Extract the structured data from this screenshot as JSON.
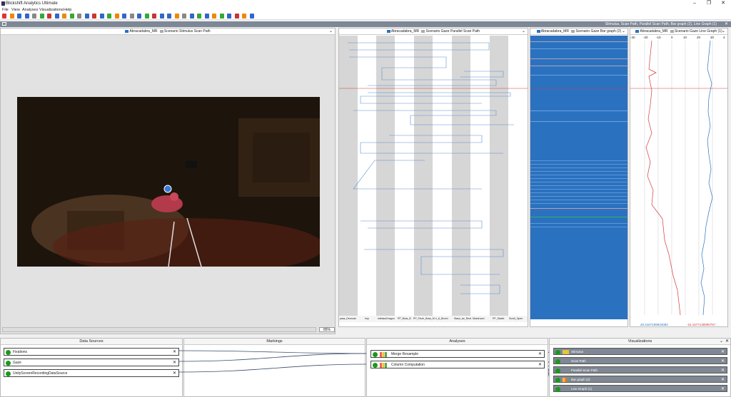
{
  "window": {
    "title": "Blickshift Analytics Ultimate",
    "minimize": "–",
    "maximize": "❐",
    "close": "✕"
  },
  "menu": [
    "File",
    "View",
    "Analyses",
    "Visualizations",
    "Help"
  ],
  "workspace": {
    "title": "Stimulus, Scan Path, Parallel Scan Path, Bar graph (2), Line Graph (1)"
  },
  "stimulus_panel": {
    "legend_a": "Abracadabra_MR",
    "legend_b": "Scenario Stimulus Scan Path",
    "zoom": "85",
    "zoom_unit": "%"
  },
  "parallel_panel": {
    "legend_a": "Abracadabra_MR",
    "legend_b": "Scenario Gaze Parallel Scan Path",
    "columns": [
      "pass_Dermola",
      "imp",
      "intefaceDragon",
      "PP_Boss_B",
      "PP_Finch_Boss_M",
      "n_A_Bronn",
      "Stasu_lar_Rest",
      "Mushroom",
      "PP_Skelet",
      "Scroll_Open"
    ]
  },
  "bar_panel": {
    "legend_a": "Abracadabra_MR",
    "legend_b": "Scenario Gaze Bar graph (2)"
  },
  "line_panel": {
    "legend_a": "Abracadabra_MR",
    "legend_b": "Scenario Gaze Line Graph (1)",
    "ticks": [
      "-30",
      "-20",
      "-10",
      "0",
      "10",
      "20",
      "30",
      "4"
    ],
    "value_left": "20.4167199944092",
    "value_right": "-15.1577138990757"
  },
  "bottom": {
    "data_sources": {
      "title": "Data Sources",
      "items": [
        "Fixations",
        "Gaze",
        "UnityScreenRecordingDataSource"
      ]
    },
    "markings": {
      "title": "Markings"
    },
    "analyses": {
      "title": "Analyses",
      "items": [
        "Merge Resample",
        "Column Computation"
      ]
    },
    "visualizations": {
      "title": "Visualizations",
      "items": [
        "Stimulus",
        "Scan Path",
        "Parallel Scan Path",
        "Bar graph (2)",
        "Line Graph (1)"
      ]
    }
  },
  "colors": {
    "blue": "#2a72c0",
    "red": "#d23b3b",
    "header": "#7d8796",
    "green": "#1a9a1a"
  }
}
